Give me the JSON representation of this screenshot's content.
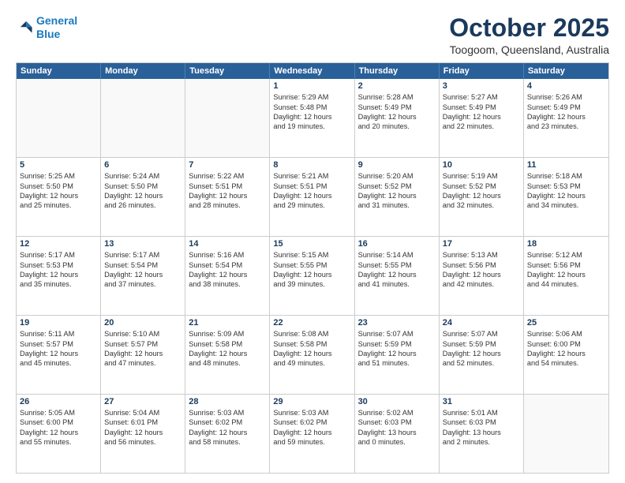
{
  "header": {
    "logo_line1": "General",
    "logo_line2": "Blue",
    "month": "October 2025",
    "location": "Toogoom, Queensland, Australia"
  },
  "days": [
    "Sunday",
    "Monday",
    "Tuesday",
    "Wednesday",
    "Thursday",
    "Friday",
    "Saturday"
  ],
  "weeks": [
    [
      {
        "day": "",
        "lines": []
      },
      {
        "day": "",
        "lines": []
      },
      {
        "day": "",
        "lines": []
      },
      {
        "day": "1",
        "lines": [
          "Sunrise: 5:29 AM",
          "Sunset: 5:48 PM",
          "Daylight: 12 hours",
          "and 19 minutes."
        ]
      },
      {
        "day": "2",
        "lines": [
          "Sunrise: 5:28 AM",
          "Sunset: 5:49 PM",
          "Daylight: 12 hours",
          "and 20 minutes."
        ]
      },
      {
        "day": "3",
        "lines": [
          "Sunrise: 5:27 AM",
          "Sunset: 5:49 PM",
          "Daylight: 12 hours",
          "and 22 minutes."
        ]
      },
      {
        "day": "4",
        "lines": [
          "Sunrise: 5:26 AM",
          "Sunset: 5:49 PM",
          "Daylight: 12 hours",
          "and 23 minutes."
        ]
      }
    ],
    [
      {
        "day": "5",
        "lines": [
          "Sunrise: 5:25 AM",
          "Sunset: 5:50 PM",
          "Daylight: 12 hours",
          "and 25 minutes."
        ]
      },
      {
        "day": "6",
        "lines": [
          "Sunrise: 5:24 AM",
          "Sunset: 5:50 PM",
          "Daylight: 12 hours",
          "and 26 minutes."
        ]
      },
      {
        "day": "7",
        "lines": [
          "Sunrise: 5:22 AM",
          "Sunset: 5:51 PM",
          "Daylight: 12 hours",
          "and 28 minutes."
        ]
      },
      {
        "day": "8",
        "lines": [
          "Sunrise: 5:21 AM",
          "Sunset: 5:51 PM",
          "Daylight: 12 hours",
          "and 29 minutes."
        ]
      },
      {
        "day": "9",
        "lines": [
          "Sunrise: 5:20 AM",
          "Sunset: 5:52 PM",
          "Daylight: 12 hours",
          "and 31 minutes."
        ]
      },
      {
        "day": "10",
        "lines": [
          "Sunrise: 5:19 AM",
          "Sunset: 5:52 PM",
          "Daylight: 12 hours",
          "and 32 minutes."
        ]
      },
      {
        "day": "11",
        "lines": [
          "Sunrise: 5:18 AM",
          "Sunset: 5:53 PM",
          "Daylight: 12 hours",
          "and 34 minutes."
        ]
      }
    ],
    [
      {
        "day": "12",
        "lines": [
          "Sunrise: 5:17 AM",
          "Sunset: 5:53 PM",
          "Daylight: 12 hours",
          "and 35 minutes."
        ]
      },
      {
        "day": "13",
        "lines": [
          "Sunrise: 5:17 AM",
          "Sunset: 5:54 PM",
          "Daylight: 12 hours",
          "and 37 minutes."
        ]
      },
      {
        "day": "14",
        "lines": [
          "Sunrise: 5:16 AM",
          "Sunset: 5:54 PM",
          "Daylight: 12 hours",
          "and 38 minutes."
        ]
      },
      {
        "day": "15",
        "lines": [
          "Sunrise: 5:15 AM",
          "Sunset: 5:55 PM",
          "Daylight: 12 hours",
          "and 39 minutes."
        ]
      },
      {
        "day": "16",
        "lines": [
          "Sunrise: 5:14 AM",
          "Sunset: 5:55 PM",
          "Daylight: 12 hours",
          "and 41 minutes."
        ]
      },
      {
        "day": "17",
        "lines": [
          "Sunrise: 5:13 AM",
          "Sunset: 5:56 PM",
          "Daylight: 12 hours",
          "and 42 minutes."
        ]
      },
      {
        "day": "18",
        "lines": [
          "Sunrise: 5:12 AM",
          "Sunset: 5:56 PM",
          "Daylight: 12 hours",
          "and 44 minutes."
        ]
      }
    ],
    [
      {
        "day": "19",
        "lines": [
          "Sunrise: 5:11 AM",
          "Sunset: 5:57 PM",
          "Daylight: 12 hours",
          "and 45 minutes."
        ]
      },
      {
        "day": "20",
        "lines": [
          "Sunrise: 5:10 AM",
          "Sunset: 5:57 PM",
          "Daylight: 12 hours",
          "and 47 minutes."
        ]
      },
      {
        "day": "21",
        "lines": [
          "Sunrise: 5:09 AM",
          "Sunset: 5:58 PM",
          "Daylight: 12 hours",
          "and 48 minutes."
        ]
      },
      {
        "day": "22",
        "lines": [
          "Sunrise: 5:08 AM",
          "Sunset: 5:58 PM",
          "Daylight: 12 hours",
          "and 49 minutes."
        ]
      },
      {
        "day": "23",
        "lines": [
          "Sunrise: 5:07 AM",
          "Sunset: 5:59 PM",
          "Daylight: 12 hours",
          "and 51 minutes."
        ]
      },
      {
        "day": "24",
        "lines": [
          "Sunrise: 5:07 AM",
          "Sunset: 5:59 PM",
          "Daylight: 12 hours",
          "and 52 minutes."
        ]
      },
      {
        "day": "25",
        "lines": [
          "Sunrise: 5:06 AM",
          "Sunset: 6:00 PM",
          "Daylight: 12 hours",
          "and 54 minutes."
        ]
      }
    ],
    [
      {
        "day": "26",
        "lines": [
          "Sunrise: 5:05 AM",
          "Sunset: 6:00 PM",
          "Daylight: 12 hours",
          "and 55 minutes."
        ]
      },
      {
        "day": "27",
        "lines": [
          "Sunrise: 5:04 AM",
          "Sunset: 6:01 PM",
          "Daylight: 12 hours",
          "and 56 minutes."
        ]
      },
      {
        "day": "28",
        "lines": [
          "Sunrise: 5:03 AM",
          "Sunset: 6:02 PM",
          "Daylight: 12 hours",
          "and 58 minutes."
        ]
      },
      {
        "day": "29",
        "lines": [
          "Sunrise: 5:03 AM",
          "Sunset: 6:02 PM",
          "Daylight: 12 hours",
          "and 59 minutes."
        ]
      },
      {
        "day": "30",
        "lines": [
          "Sunrise: 5:02 AM",
          "Sunset: 6:03 PM",
          "Daylight: 13 hours",
          "and 0 minutes."
        ]
      },
      {
        "day": "31",
        "lines": [
          "Sunrise: 5:01 AM",
          "Sunset: 6:03 PM",
          "Daylight: 13 hours",
          "and 2 minutes."
        ]
      },
      {
        "day": "",
        "lines": []
      }
    ]
  ]
}
